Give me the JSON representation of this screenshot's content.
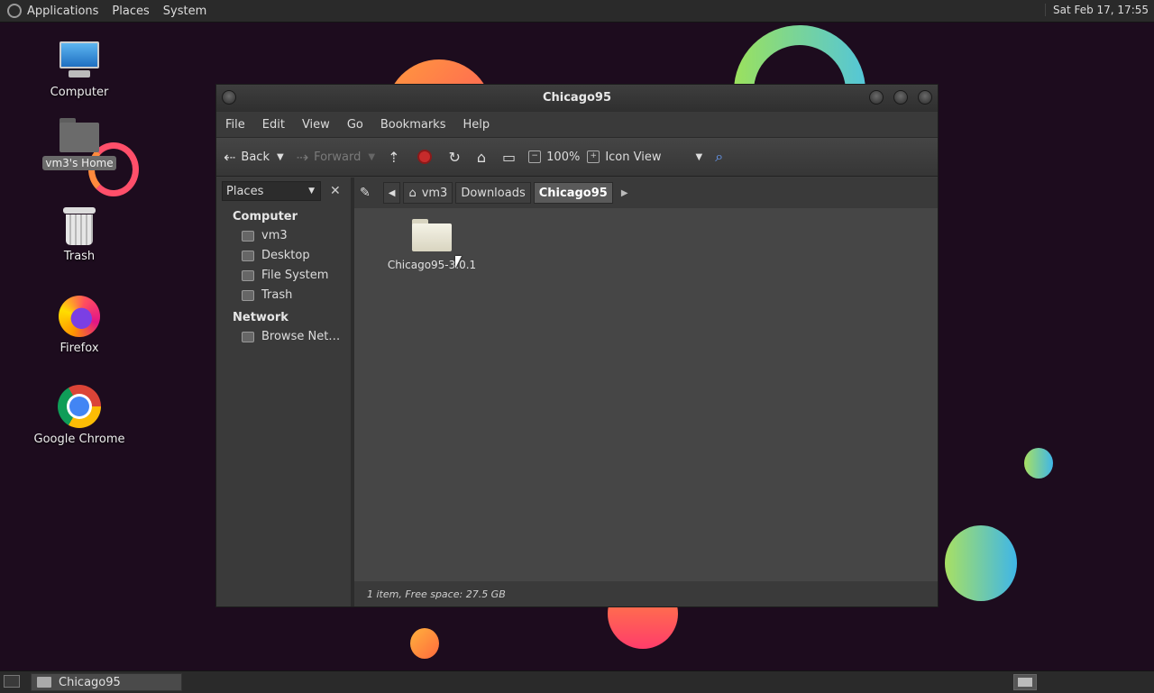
{
  "top_panel": {
    "menus": [
      "Applications",
      "Places",
      "System"
    ],
    "clock": "Sat Feb 17, 17:55"
  },
  "desktop": {
    "icons": [
      {
        "label": "Computer",
        "icon": "computer-icon"
      },
      {
        "label": "vm3's Home",
        "icon": "home-folder-icon",
        "selected": true
      },
      {
        "label": "Trash",
        "icon": "trash-icon"
      },
      {
        "label": "Firefox",
        "icon": "firefox-icon"
      },
      {
        "label": "Google Chrome",
        "icon": "chrome-icon"
      }
    ]
  },
  "window": {
    "title": "Chicago95",
    "menubar": [
      "File",
      "Edit",
      "View",
      "Go",
      "Bookmarks",
      "Help"
    ],
    "toolbar": {
      "back": "Back",
      "forward": "Forward",
      "zoom": "100%",
      "view_mode": "Icon View"
    },
    "sidebar": {
      "selector": "Places",
      "sections": [
        {
          "title": "Computer",
          "items": [
            "vm3",
            "Desktop",
            "File System",
            "Trash"
          ]
        },
        {
          "title": "Network",
          "items": [
            "Browse Net…"
          ]
        }
      ]
    },
    "pathbar": [
      "vm3",
      "Downloads",
      "Chicago95"
    ],
    "files": [
      {
        "name": "Chicago95-3.0.1",
        "type": "folder"
      }
    ],
    "status": "1 item, Free space: 27.5 GB"
  },
  "bottom_panel": {
    "tasks": [
      "Chicago95"
    ]
  },
  "colors": {
    "desktop_bg": "#1d0c1e",
    "panel_bg": "#2a2a2a",
    "window_bg": "#3c3c3c",
    "stop_red": "#c62b2b"
  }
}
